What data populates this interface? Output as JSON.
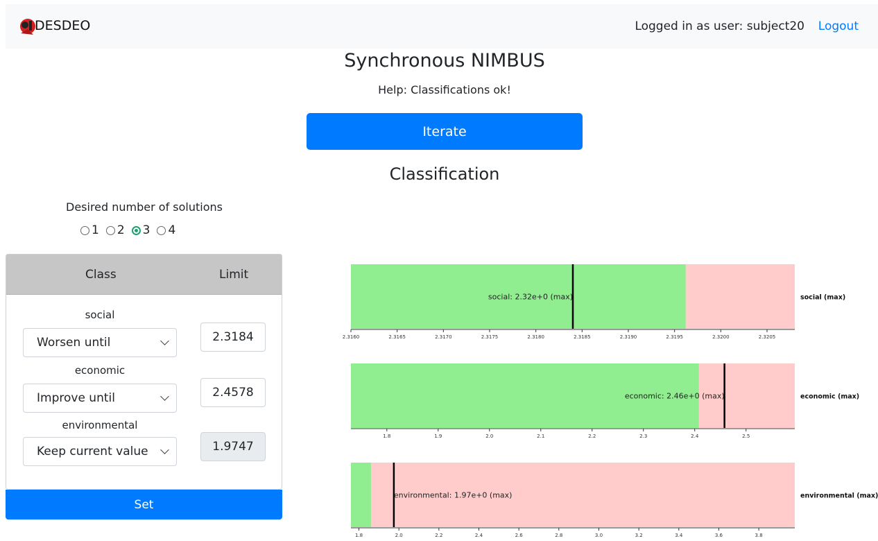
{
  "navbar": {
    "brand": "DESDEO",
    "user_text": "Logged in as user: subject20",
    "logout": "Logout"
  },
  "page": {
    "title": "Synchronous NIMBUS",
    "help": "Help: Classifications ok!",
    "iterate_label": "Iterate",
    "section_title": "Classification"
  },
  "solutions": {
    "label": "Desired number of solutions",
    "options": [
      "1",
      "2",
      "3",
      "4"
    ],
    "selected": "3"
  },
  "table": {
    "header_class": "Class",
    "header_limit": "Limit",
    "rows": [
      {
        "objective": "social",
        "classification": "Worsen until",
        "limit": "2.3184",
        "disabled": false
      },
      {
        "objective": "economic",
        "classification": "Improve until",
        "limit": "2.4578",
        "disabled": false
      },
      {
        "objective": "environmental",
        "classification": "Keep current value",
        "limit": "1.9747",
        "disabled": true
      }
    ],
    "set_label": "Set"
  },
  "colors": {
    "primary": "#007bff",
    "green_fill": "#90ee90",
    "red_fill": "#ffcccb",
    "radio_checked": "#20a070"
  },
  "chart_data": [
    {
      "type": "bar",
      "name": "social",
      "side_label": "social (max)",
      "bar_label": "social: 2.32e+0 (max)",
      "xlim": [
        2.316,
        2.3208
      ],
      "green_end": 2.31962,
      "current_value": 2.3184,
      "ticks": [
        "2.3160",
        "2.3165",
        "2.3170",
        "2.3175",
        "2.3180",
        "2.3185",
        "2.3190",
        "2.3195",
        "2.3200",
        "2.3205"
      ],
      "tick_values": [
        2.316,
        2.3165,
        2.317,
        2.3175,
        2.318,
        2.3185,
        2.319,
        2.3195,
        2.32,
        2.3205
      ]
    },
    {
      "type": "bar",
      "name": "economic",
      "side_label": "economic (max)",
      "bar_label": "economic: 2.46e+0 (max)",
      "xlim": [
        1.73,
        2.595
      ],
      "green_end": 2.408,
      "current_value": 2.458,
      "ticks": [
        "1.8",
        "1.9",
        "2.0",
        "2.1",
        "2.2",
        "2.3",
        "2.4",
        "2.5"
      ],
      "tick_values": [
        1.8,
        1.9,
        2.0,
        2.1,
        2.2,
        2.3,
        2.4,
        2.5
      ]
    },
    {
      "type": "bar",
      "name": "environmental",
      "side_label": "environmental (max)",
      "bar_label": "environmental: 1.97e+0 (max)",
      "xlim": [
        1.76,
        3.98
      ],
      "green_end": 1.86,
      "current_value": 1.9747,
      "ticks": [
        "1.8",
        "2.0",
        "2.2",
        "2.4",
        "2.6",
        "2.8",
        "3.0",
        "3.2",
        "3.4",
        "3.6",
        "3.8"
      ],
      "tick_values": [
        1.8,
        2.0,
        2.2,
        2.4,
        2.6,
        2.8,
        3.0,
        3.2,
        3.4,
        3.6,
        3.8
      ]
    }
  ]
}
